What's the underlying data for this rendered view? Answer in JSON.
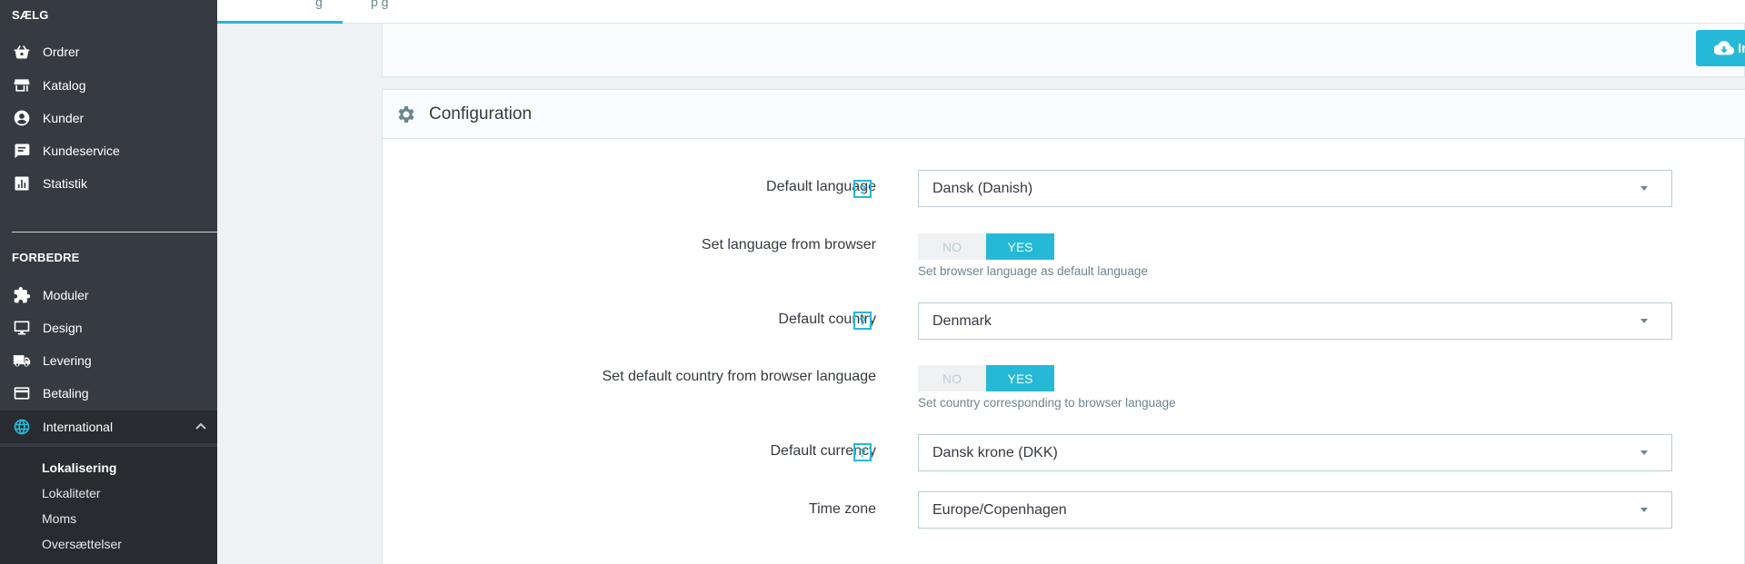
{
  "sidebar": {
    "section_sell": "SÆLG",
    "sell_items": [
      {
        "label": "Ordrer",
        "icon": "basket-icon"
      },
      {
        "label": "Katalog",
        "icon": "store-icon"
      },
      {
        "label": "Kunder",
        "icon": "account-circle-icon"
      },
      {
        "label": "Kundeservice",
        "icon": "chat-icon"
      },
      {
        "label": "Statistik",
        "icon": "bar-chart-icon"
      }
    ],
    "section_improve": "FORBEDRE",
    "improve_items": [
      {
        "label": "Moduler",
        "icon": "puzzle-icon"
      },
      {
        "label": "Design",
        "icon": "desktop-icon"
      },
      {
        "label": "Levering",
        "icon": "truck-icon"
      },
      {
        "label": "Betaling",
        "icon": "credit-card-icon"
      },
      {
        "label": "International",
        "icon": "globe-icon"
      }
    ],
    "sub_items": [
      "Lokalisering",
      "Lokaliteter",
      "Moms",
      "Oversættelser"
    ]
  },
  "tabs": {
    "fragment_1": "g",
    "fragment_2": "p g"
  },
  "import_button": {
    "label": "Ir",
    "icon": "cloud-download-icon"
  },
  "config": {
    "title": "Configuration",
    "icon": "gear-icon",
    "help_glyph": "?",
    "default_language": {
      "label": "Default language",
      "value": "Dansk (Danish)"
    },
    "language_from_browser": {
      "label": "Set language from browser",
      "no": "NO",
      "yes": "YES",
      "help": "Set browser language as default language"
    },
    "default_country": {
      "label": "Default country",
      "value": "Denmark"
    },
    "country_from_browser": {
      "label": "Set default country from browser language",
      "no": "NO",
      "yes": "YES",
      "help": "Set country corresponding to browser language"
    },
    "default_currency": {
      "label": "Default currency",
      "value": "Dansk krone (DKK)"
    },
    "time_zone": {
      "label": "Time zone",
      "value": "Europe/Copenhagen"
    }
  },
  "colors": {
    "accent": "#25b9d7",
    "sidebar_bg": "#363a41",
    "sidebar_active": "#282b30"
  }
}
